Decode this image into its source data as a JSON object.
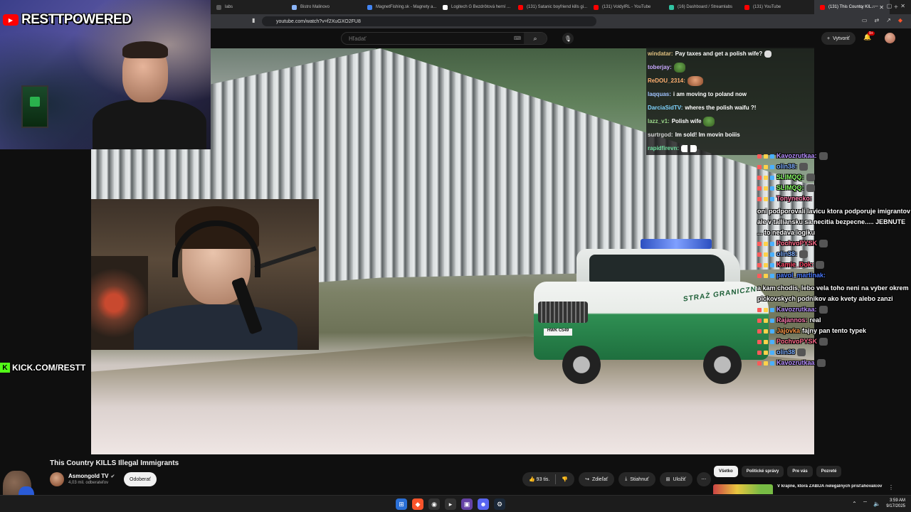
{
  "browser": {
    "tabs": [
      {
        "label": "labs",
        "color": "#5a5a5a"
      },
      {
        "label": "Bistro Malinovo",
        "color": "#8ab4f8"
      },
      {
        "label": "MagnetFishing.sk - Magnety a...",
        "color": "#4285f4"
      },
      {
        "label": "Logitech G Bezdrôtová herní ...",
        "color": "#ffffff"
      },
      {
        "label": "(131) Satanic boyfriend kills gi...",
        "color": "#ff0000"
      },
      {
        "label": "(131) VoldyIRL - YouTube",
        "color": "#ff0000"
      },
      {
        "label": "(16) Dashboard / Streamlabs",
        "color": "#31c3a2"
      },
      {
        "label": "(131) YouTube",
        "color": "#ff0000"
      },
      {
        "label": "(131) This Country KIL...",
        "color": "#ff0000",
        "active": true
      }
    ],
    "new_tab": "+",
    "url": "youtube.com/watch?v=f2XuGXO2FU8"
  },
  "youtube": {
    "search_placeholder": "Hľadať",
    "create_label": "Vytvoriť",
    "notif_badge": "9+",
    "video_title": "This Country KILLS Illegal Immigrants",
    "channel_name": "Asmongold TV",
    "subscribers": "4,03 mil. odberateľov",
    "subscribe_label": "Odoberať",
    "likes": "93 tis.",
    "share_label": "Zdieľať",
    "download_label": "Stiahnuť",
    "save_label": "Uložiť",
    "chips": [
      "Všetko",
      "Politické správy",
      "Pre vás",
      "Pozreté"
    ],
    "rec_title": "V krajine, ktorá ZABÍJA nelegálnych prisťahovalcov"
  },
  "overlay": {
    "brand_text": "RESTTPOWERED",
    "kick_text": "KICK.COM/RESTT",
    "car_door_text": "STRAŻ GRANICZNA",
    "car_plate": "HWK C549"
  },
  "chat_top": [
    {
      "name": "windatar:",
      "color": "#e0c080",
      "msg": "Pay taxes and get a polish wife?",
      "emote": "e-paw"
    },
    {
      "name": "toberjay:",
      "color": "#c8a8ff",
      "msg": "",
      "emote": "e-frog"
    },
    {
      "name": "ReDOU_2314:",
      "color": "#ffb070",
      "msg": "",
      "emote": "e-face"
    },
    {
      "name": "laqquas:",
      "color": "#a0c4ff",
      "msg": "i am moving to poland now",
      "emote": ""
    },
    {
      "name": "DarciaSidTV:",
      "color": "#7fd4ff",
      "msg": "wheres the polish waifu ?!",
      "emote": ""
    },
    {
      "name": "lazz_v1:",
      "color": "#9ad68a",
      "msg": "Polish wife",
      "emote": "e-frog"
    },
    {
      "name": "surtrgod:",
      "color": "#cfcfcf",
      "msg": "Im sold! Im movin boiiis",
      "emote": ""
    },
    {
      "name": "rapidfirevn:",
      "color": "#6fe0a0",
      "msg": "",
      "emote": "e-pep"
    }
  ],
  "chat_side": [
    {
      "name": "Kavozrutkaa:",
      "color": "#b890ff",
      "msg": ""
    },
    {
      "name": "olin38:",
      "color": "#7fb0ff",
      "msg": ""
    },
    {
      "name": "SLIMQQ:",
      "color": "#8cff6a",
      "msg": ""
    },
    {
      "name": "SLIMQQ:",
      "color": "#8cff6a",
      "msg": ""
    },
    {
      "name": "Tonynecko:",
      "color": "#ff7aa8",
      "msg": "oni podporovali lavicu ktora podporuje imigrantov ale v talliansku sa necitia bezpecne..... JEBNUTE ... to nedava logiku"
    },
    {
      "name": "PochvoPYSK",
      "color": "#ff6a8a",
      "msg": ""
    },
    {
      "name": "olin38:",
      "color": "#7fb0ff",
      "msg": ""
    },
    {
      "name": "Kamie_Dok:",
      "color": "#ff4a6a",
      "msg": ""
    },
    {
      "name": "pavol_martinak:",
      "color": "#4a7aff",
      "msg": "a kam chodis, lebo vela toho neni na vyber okrem pickovskych podnikov ako kvety alebo zanzi"
    },
    {
      "name": "Kavozrutkaa:",
      "color": "#b890ff",
      "msg": ""
    },
    {
      "name": "Rajannos:",
      "color": "#ff7ab0",
      "msg": "real"
    },
    {
      "name": "Jajovka",
      "color": "#ff9a4a",
      "msg": "fajny pan tento typek"
    },
    {
      "name": "PochvoPYSK",
      "color": "#ff6a8a",
      "msg": ""
    },
    {
      "name": "olin38",
      "color": "#7fb0ff",
      "msg": ""
    },
    {
      "name": "Kavozrutkaa",
      "color": "#b890ff",
      "msg": ""
    }
  ],
  "taskbar": {
    "time": "3:59 AM",
    "date": "9/17/2025"
  }
}
